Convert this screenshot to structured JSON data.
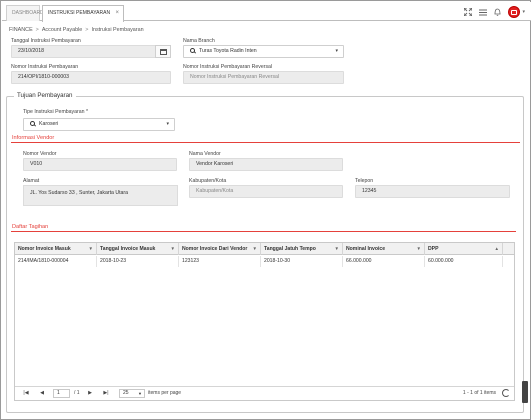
{
  "tabs": [
    {
      "label": "DASHBOARD"
    },
    {
      "label": "INSTRUKSI PEMBAYARAN",
      "close": "×"
    }
  ],
  "breadcrumb": [
    "FINANCE",
    "Account Payable",
    "Instruksi Pembayaran"
  ],
  "breadcrumb_sep": ">",
  "form": {
    "tanggal_label": "Tanggal Instruksi Pembayaran",
    "tanggal_value": "23/10/2018",
    "branch_label": "Nama Branch",
    "branch_value": "Turas Toyota Radin Inten",
    "nomor_label": "Nomor Instruksi Pembayaran",
    "nomor_value": "214/OPI/1810-000003",
    "reversal_label": "Nomor Instruksi Pembayaran Reversal",
    "reversal_placeholder": "Nomor Instruksi Pembayaran Reversal"
  },
  "tujuan": {
    "legend": "Tujuan Pembayaran",
    "tipe_label": "Tipe Instruksi Pembayaran *",
    "tipe_value": "Karoseri"
  },
  "vendor": {
    "title": "Informasi Vendor",
    "nomor_label": "Nomor Vendor",
    "nomor_value": "V010",
    "nama_label": "Nama Vendor",
    "nama_value": "Vendor Karoseri",
    "alamat_label": "Alamat",
    "alamat_value": "JL. Yos Sudarso 33 , Sunter, Jakarta Utara",
    "kota_label": "Kabupaten/Kota",
    "kota_placeholder": "Kabupaten/Kota",
    "telepon_label": "Telepon",
    "telepon_value": "12345"
  },
  "tagihan": {
    "title": "Daftar Tagihan",
    "columns": [
      "Nomor Invoice Masuk",
      "Tanggal Invoice Masuk",
      "Nomor Invoice Dari Vendor",
      "Tanggal Jatuh Tempo",
      "Nominal Invoice",
      "DPP"
    ],
    "rows": [
      [
        "214/IMA/1810-000004",
        "2018-10-23",
        "123123",
        "2018-10-30",
        "66.000.000",
        "60.000.000"
      ]
    ]
  },
  "pager": {
    "first": "|◀",
    "prev": "◀",
    "page": "1",
    "of": "/ 1",
    "next": "▶",
    "last": "▶|",
    "page_size": "25",
    "per_page": "items per page",
    "summary": "1 - 1 of 1 items"
  },
  "icons": {
    "expand": "expand-icon",
    "menu": "menu-icon",
    "bell": "bell-icon",
    "user": "user-icon",
    "calendar": "calendar-icon",
    "search": "search-icon",
    "refresh": "refresh-icon"
  },
  "colors": {
    "accent": "#e5413b",
    "user_button": "#e02020"
  }
}
